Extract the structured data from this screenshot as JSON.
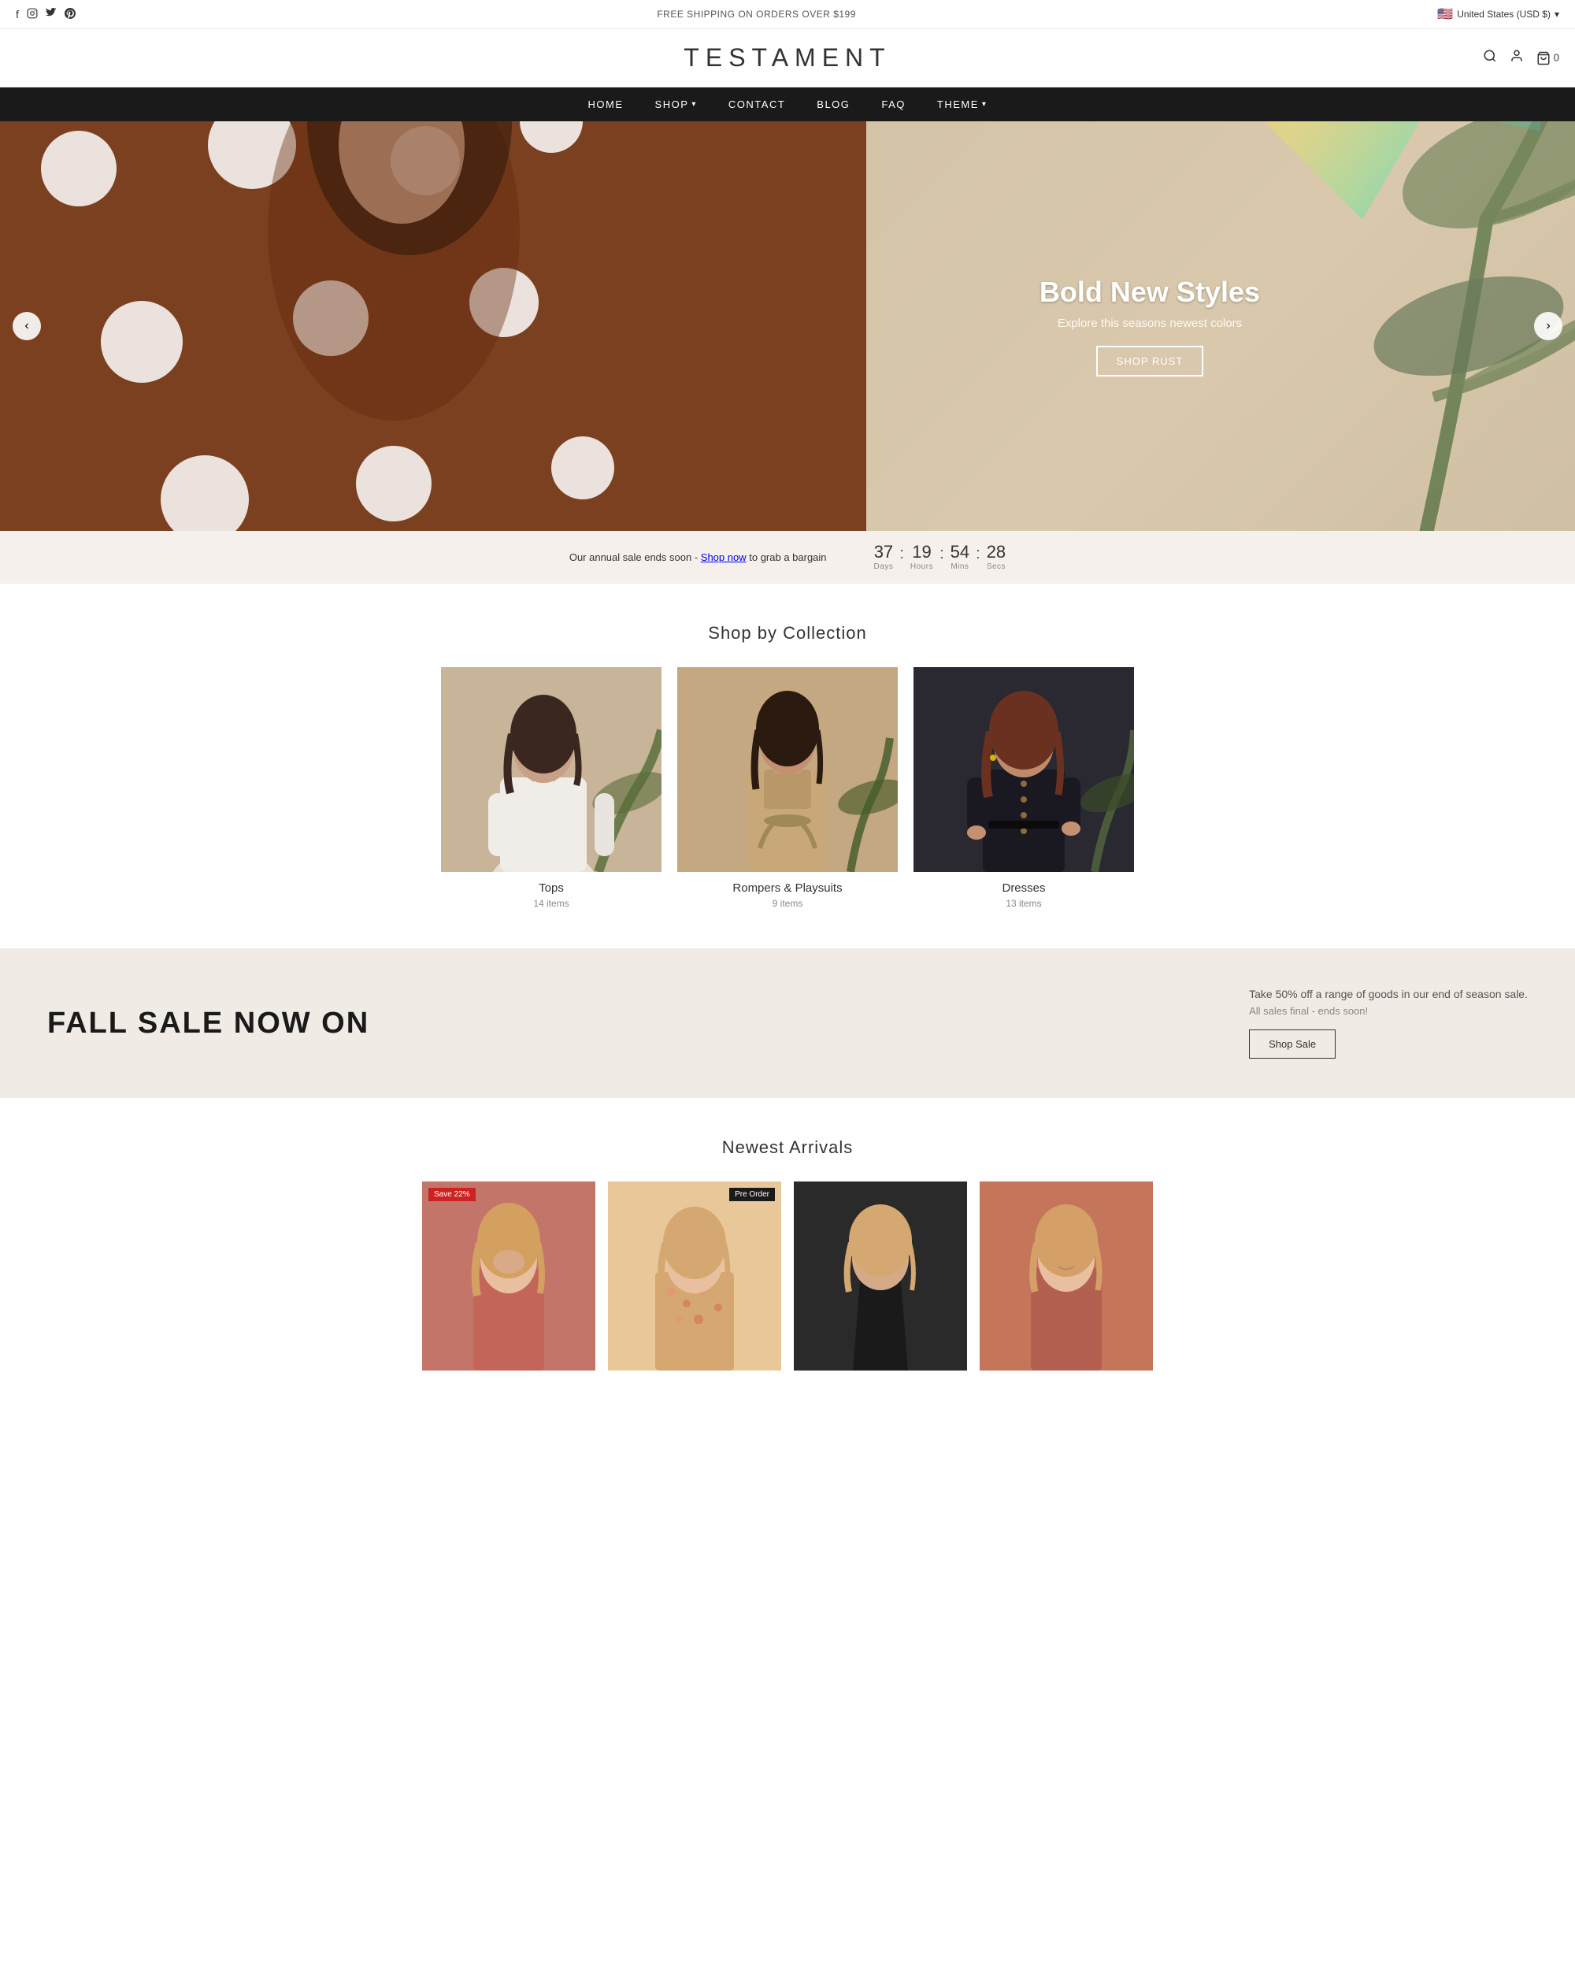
{
  "topbar": {
    "shipping": "FREE SHIPPING ON ORDERS OVER $199",
    "region": "United States (USD $)",
    "social": [
      "f",
      "ig",
      "tw",
      "pi"
    ]
  },
  "header": {
    "logo": "TESTAMENT",
    "cart_count": "0"
  },
  "nav": {
    "items": [
      {
        "label": "HOME",
        "has_dropdown": false
      },
      {
        "label": "SHOP",
        "has_dropdown": true
      },
      {
        "label": "CONTACT",
        "has_dropdown": false
      },
      {
        "label": "BLOG",
        "has_dropdown": false
      },
      {
        "label": "FAQ",
        "has_dropdown": false
      },
      {
        "label": "THEME",
        "has_dropdown": true
      }
    ]
  },
  "hero": {
    "title": "Bold New Styles",
    "subtitle": "Explore this seasons newest colors",
    "btn_label": "Shop Rust",
    "prev_label": "‹",
    "next_label": "›"
  },
  "countdown": {
    "text_before": "Our annual sale ends soon -",
    "link_text": "Shop now",
    "text_after": "to grab a bargain",
    "days": "37",
    "hours": "19",
    "mins": "54",
    "secs": "28",
    "labels": {
      "days": "Days",
      "hours": "Hours",
      "mins": "Mins",
      "secs": "Secs"
    }
  },
  "collections": {
    "section_title": "Shop by Collection",
    "items": [
      {
        "name": "Tops",
        "count": "14 items"
      },
      {
        "name": "Rompers & Playsuits",
        "count": "9 items"
      },
      {
        "name": "Dresses",
        "count": "13 items"
      }
    ]
  },
  "sale_banner": {
    "title": "FALL SALE NOW ON",
    "desc": "Take 50% off a range of goods in our end of season sale.",
    "sub": "All sales final - ends soon!",
    "btn_label": "Shop Sale"
  },
  "newest": {
    "section_title": "Newest Arrivals",
    "products": [
      {
        "badge": "Save 22%",
        "badge_type": "sale"
      },
      {
        "badge": "Pre Order",
        "badge_type": "preorder"
      },
      {},
      {}
    ]
  }
}
